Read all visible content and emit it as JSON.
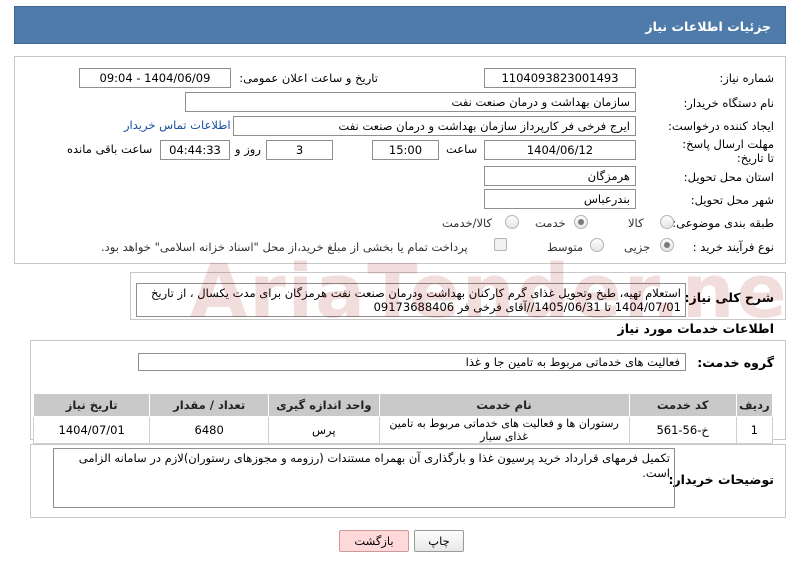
{
  "header": {
    "title": "جزئیات اطلاعات نیاز"
  },
  "form": {
    "need_number_label": "شماره نیاز:",
    "need_number": "1104093823001493",
    "announce_label": "تاریخ و ساعت اعلان عمومی:",
    "announce_value": "1404/06/09 - 09:04",
    "buyer_org_label": "نام دستگاه خریدار:",
    "buyer_org": "سازمان بهداشت و درمان صنعت نفت",
    "requester_label": "ایجاد کننده درخواست:",
    "requester": "ایرج فرخی فر کارپرداز  سازمان بهداشت و درمان صنعت نفت",
    "contact_link": "اطلاعات تماس خریدار",
    "deadline_label": "مهلت ارسال پاسخ: تا تاریخ:",
    "deadline_date": "1404/06/12",
    "time_label": "ساعت",
    "deadline_time": "15:00",
    "days_value": "3",
    "days_label": "روز و",
    "remaining_time": "04:44:33",
    "remaining_label": "ساعت باقی مانده",
    "province_label": "استان محل تحویل:",
    "province": "هرمزگان",
    "city_label": "شهر محل تحویل:",
    "city": "بندرعباس",
    "category_label": "طبقه بندی موضوعی:",
    "category_options": [
      "کالا",
      "خدمت",
      "کالا/خدمت"
    ],
    "process_label": "نوع فرآیند خرید :",
    "process_options": [
      "جزیی",
      "متوسط"
    ],
    "payment_note": "پرداخت تمام یا بخشی از مبلغ خرید،از محل \"اسناد خزانه اسلامی\" خواهد بود."
  },
  "summary": {
    "label": "شرح کلی نیاز:",
    "text": "استعلام تهیه، طبخ وتحویل غذای گرم کارکنان بهداشت ودرمان صنعت نفت هرمزگان برای مدت یکسال ، از تاریخ 1404/07/01 تا 1405/06/31//آقای فرخی فر 09173688406"
  },
  "services": {
    "section_title": "اطلاعات خدمات مورد نیاز",
    "group_label": "گروه خدمت:",
    "group_value": "فعالیت های خدماتی مربوط به تامین جا و غذا",
    "columns": [
      "ردیف",
      "کد خدمت",
      "نام خدمت",
      "واحد اندازه گیری",
      "تعداد / مقدار",
      "تاریخ نیاز"
    ],
    "rows": [
      [
        "1",
        "خ-56-561",
        "رستوران ها و فعالیت های خدماتی مربوط به تامین غذای سیار",
        "پرس",
        "6480",
        "1404/07/01"
      ]
    ]
  },
  "buyer_notes": {
    "label": "توضیحات خریدار:",
    "text": "تکمیل فرمهای قرارداد خرید پرسیون غذا و بارگذاری آن بهمراه مستندات (رزومه و مجوزهای رستوران)لازم در سامانه الزامی است."
  },
  "buttons": {
    "print": "چاپ",
    "back": "بازگشت"
  },
  "watermark": "AriaTender.net"
}
